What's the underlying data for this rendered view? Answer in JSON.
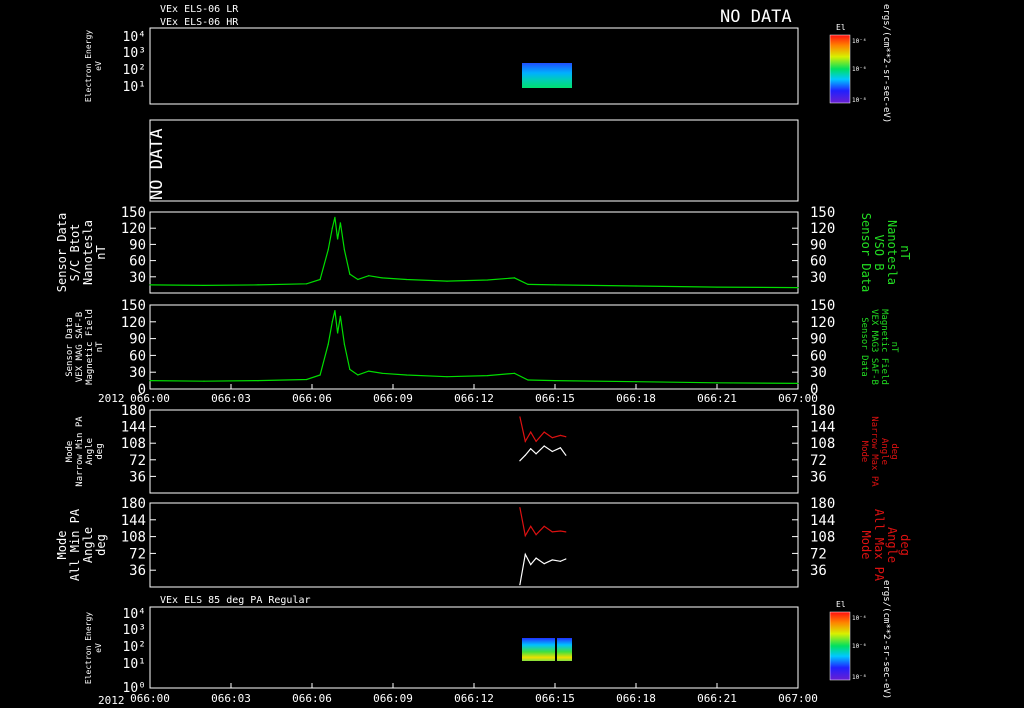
{
  "header": {
    "line1": "VEx ELS-06 LR",
    "line2": "VEx ELS-06 HR",
    "no_data": "NO DATA"
  },
  "x_axis": {
    "year_label": "2012",
    "ticks": [
      "066:00",
      "066:03",
      "066:06",
      "066:09",
      "066:12",
      "066:15",
      "066:18",
      "066:21",
      "067:00"
    ]
  },
  "colorbar": {
    "title": "El",
    "tick_labels": [
      "10⁻⁴",
      "10⁻⁶",
      "10⁻⁸"
    ],
    "unit_label": "ergs/(cm**2-sr-sec-eV)"
  },
  "panels": {
    "p1": {
      "ylabel": [
        "Electron Energy",
        "eV"
      ]
    },
    "p2": {
      "no_data": "NO DATA"
    },
    "p3": {
      "left_label": [
        "Sensor Data",
        "S/C Btot",
        "Nanotesla",
        "nT"
      ],
      "right_label": [
        "Sensor Data",
        "VSO B",
        "Nanotesla",
        "nT"
      ]
    },
    "p4": {
      "left_label": [
        "Sensor Data",
        "VEX MAG SAF-B",
        "Magnetic Field",
        "nT"
      ],
      "right_label": [
        "Sensor Data",
        "VEX MAG3 SAF-B",
        "Magnetic Field",
        "nT"
      ]
    },
    "p5": {
      "left_label": [
        "Mode",
        "Narrow Min PA",
        "Angle",
        "deg"
      ],
      "right_label": [
        "Mode",
        "Narrow Max PA",
        "Angle",
        "deg"
      ]
    },
    "p6": {
      "left_label": [
        "Mode",
        "All Min PA",
        "Angle",
        "deg"
      ],
      "right_label": [
        "Mode",
        "All Max PA",
        "Angle",
        "deg"
      ]
    },
    "p7": {
      "title": "VEx ELS 85 deg PA Regular",
      "ylabel": [
        "Electron Energy",
        "eV"
      ]
    }
  },
  "colors": {
    "background": "#000000",
    "axes": "#ffffff",
    "mag_trace": "#00dd00",
    "min_pa": "#ffffff",
    "max_pa": "#dd1111"
  },
  "chart_data": [
    {
      "type": "heatmap",
      "name": "ELS-06 electron energy spectrogram",
      "x_range": [
        "066:00",
        "067:00"
      ],
      "y_scale": "log",
      "y_range": [
        1,
        10000
      ],
      "y_ticks": [
        "10⁴",
        "10³",
        "10²",
        "10¹"
      ],
      "data_x_range": [
        "066:13.7",
        "066:15.3"
      ],
      "data_y_range": [
        10,
        250
      ]
    },
    {
      "type": "table",
      "no_data": true
    },
    {
      "type": "line",
      "y_ticks": [
        30,
        60,
        90,
        120,
        150
      ],
      "ylim": [
        0,
        150
      ],
      "x_unit": "minutes since 066:00",
      "series": [
        {
          "x": [
            0,
            2,
            4,
            5.8,
            6.3,
            6.6,
            6.75,
            6.85,
            6.95,
            7.05,
            7.2,
            7.4,
            7.7,
            8.1,
            8.6,
            9.5,
            11,
            12.5,
            13.5,
            14,
            15,
            18,
            21,
            24
          ],
          "y": [
            15,
            14,
            15,
            17,
            25,
            80,
            120,
            140,
            100,
            130,
            80,
            35,
            25,
            32,
            28,
            25,
            22,
            24,
            28,
            16,
            15,
            13,
            11,
            10
          ]
        }
      ]
    },
    {
      "type": "line",
      "y_ticks": [
        0,
        30,
        60,
        90,
        120,
        150
      ],
      "ylim": [
        0,
        150
      ],
      "series": [
        {
          "x": [
            0,
            2,
            4,
            5.8,
            6.3,
            6.6,
            6.75,
            6.85,
            6.95,
            7.05,
            7.2,
            7.4,
            7.7,
            8.1,
            8.6,
            9.5,
            11,
            12.5,
            13.5,
            14,
            15,
            18,
            21,
            24
          ],
          "y": [
            15,
            14,
            15,
            17,
            25,
            80,
            120,
            140,
            100,
            130,
            80,
            35,
            25,
            32,
            28,
            25,
            22,
            24,
            28,
            16,
            15,
            13,
            11,
            10
          ]
        }
      ]
    },
    {
      "type": "line",
      "y_ticks": [
        36,
        72,
        108,
        144,
        180
      ],
      "ylim": [
        0,
        180
      ],
      "series": [
        {
          "x": [
            13.7,
            13.9,
            14.1,
            14.3,
            14.6,
            14.9,
            15.2,
            15.4
          ],
          "y": [
            165,
            112,
            132,
            112,
            132,
            120,
            125,
            122
          ]
        },
        {
          "x": [
            13.7,
            13.9,
            14.1,
            14.3,
            14.6,
            14.9,
            15.2,
            15.4
          ],
          "y": [
            70,
            82,
            96,
            85,
            102,
            90,
            98,
            82
          ]
        }
      ]
    },
    {
      "type": "line",
      "y_ticks": [
        36,
        72,
        108,
        144,
        180
      ],
      "ylim": [
        0,
        180
      ],
      "series": [
        {
          "x": [
            13.7,
            13.9,
            14.1,
            14.3,
            14.6,
            14.9,
            15.2,
            15.4
          ],
          "y": [
            170,
            110,
            130,
            112,
            130,
            118,
            120,
            118
          ]
        },
        {
          "x": [
            13.7,
            13.9,
            14.1,
            14.3,
            14.6,
            14.9,
            15.2,
            15.4
          ],
          "y": [
            5,
            70,
            48,
            62,
            50,
            58,
            55,
            60
          ]
        }
      ]
    },
    {
      "type": "heatmap",
      "name": "ELS 85 deg PA regular spectrogram",
      "x_range": [
        "066:00",
        "067:00"
      ],
      "y_scale": "log",
      "y_range": [
        1,
        10000
      ],
      "y_ticks": [
        "10⁴",
        "10³",
        "10²",
        "10¹",
        "10⁰"
      ],
      "data_x_range": [
        "066:13.7",
        "066:15.3"
      ],
      "data_y_range": [
        5,
        250
      ]
    }
  ]
}
